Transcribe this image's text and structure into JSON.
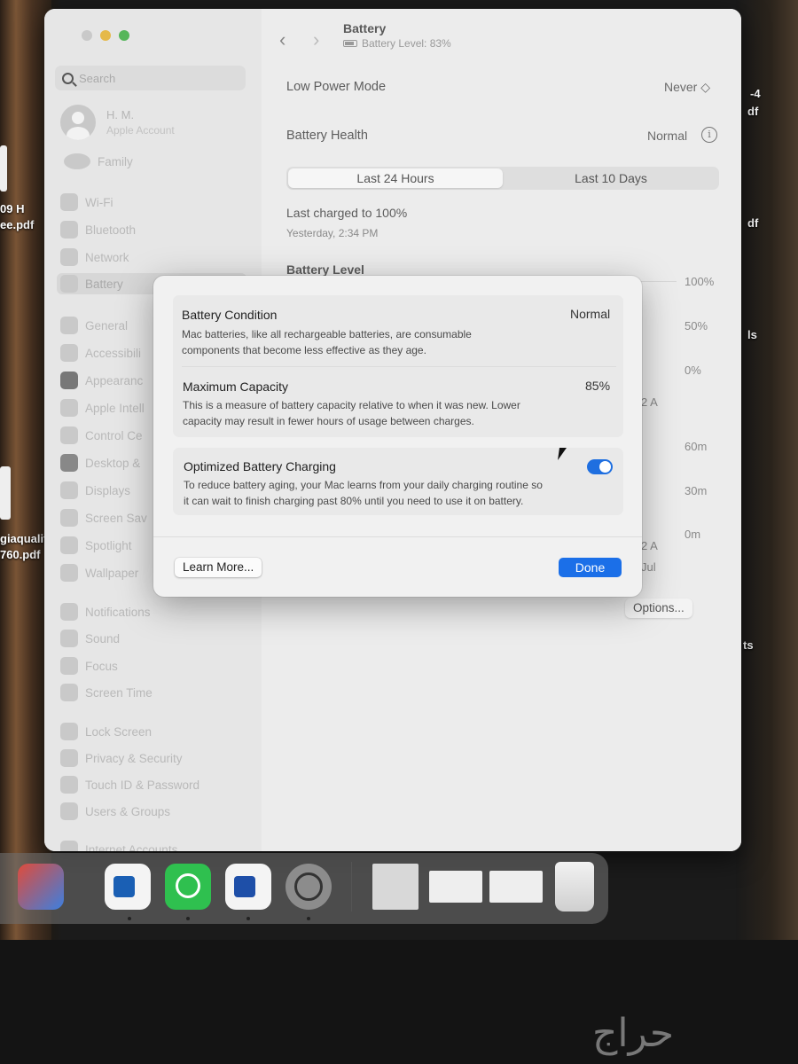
{
  "desktop": {
    "labels": [
      "-4",
      "df",
      "09 H",
      "ee.pdf",
      "df",
      "ls",
      "giaqualit",
      "760.pdf",
      "ts"
    ]
  },
  "window": {
    "title": "Battery",
    "subtitle": "Battery Level: 83%",
    "nav_back_glyph": "‹",
    "nav_forward_glyph": "›"
  },
  "sidebar": {
    "search_placeholder": "Search",
    "account_name": "H. M.",
    "account_sub": "Apple Account",
    "family": "Family",
    "items": [
      {
        "label": "Wi-Fi",
        "icon": "wifi-icon"
      },
      {
        "label": "Bluetooth",
        "icon": "bluetooth-icon"
      },
      {
        "label": "Network",
        "icon": "globe-icon"
      },
      {
        "label": "Battery",
        "icon": "battery-icon"
      },
      {
        "label": "General",
        "icon": "gear-icon"
      },
      {
        "label": "Accessibili",
        "icon": "accessibility-icon"
      },
      {
        "label": "Appearanc",
        "icon": "appearance-icon"
      },
      {
        "label": "Apple Intell",
        "icon": "apple-intelligence-icon"
      },
      {
        "label": "Control Ce",
        "icon": "control-center-icon"
      },
      {
        "label": "Desktop &",
        "icon": "desktop-dock-icon"
      },
      {
        "label": "Displays",
        "icon": "displays-icon"
      },
      {
        "label": "Screen Sav",
        "icon": "screensaver-icon"
      },
      {
        "label": "Spotlight",
        "icon": "spotlight-icon"
      },
      {
        "label": "Wallpaper",
        "icon": "wallpaper-icon"
      },
      {
        "label": "Notifications",
        "icon": "notifications-icon"
      },
      {
        "label": "Sound",
        "icon": "sound-icon"
      },
      {
        "label": "Focus",
        "icon": "focus-icon"
      },
      {
        "label": "Screen Time",
        "icon": "screen-time-icon"
      },
      {
        "label": "Lock Screen",
        "icon": "lock-icon"
      },
      {
        "label": "Privacy & Security",
        "icon": "privacy-hand-icon"
      },
      {
        "label": "Touch ID & Password",
        "icon": "fingerprint-icon"
      },
      {
        "label": "Users & Groups",
        "icon": "users-icon"
      },
      {
        "label": "Internet Accounts",
        "icon": "at-icon"
      }
    ]
  },
  "main": {
    "low_power_label": "Low Power Mode",
    "low_power_value": "Never ◇",
    "health_label": "Battery Health",
    "health_value": "Normal",
    "info_glyph": "i",
    "tabs": [
      "Last 24 Hours",
      "Last 10 Days"
    ],
    "last_charged": "Last charged to 100%",
    "last_charged_time": "Yesterday, 2:34 PM",
    "battery_level_heading": "Battery Level",
    "level_axis": [
      "100%",
      "50%",
      "0%"
    ],
    "time_axis": [
      "60m",
      "30m",
      "0m"
    ],
    "partial_labels": [
      "2 A",
      "2 A",
      "Jul"
    ],
    "options_label": "Options...",
    "help_label": "?"
  },
  "modal": {
    "condition_title": "Battery Condition",
    "condition_value": "Normal",
    "condition_desc_1": "Mac batteries, like all rechargeable batteries, are consumable",
    "condition_desc_2": "components that become less effective as they age.",
    "capacity_title": "Maximum Capacity",
    "capacity_value": "85%",
    "capacity_desc_1": "This is a measure of battery capacity relative to when it was new. Lower",
    "capacity_desc_2": "capacity may result in fewer hours of usage between charges.",
    "optimized_title": "Optimized Battery Charging",
    "optimized_desc_1": "To reduce battery aging, your Mac learns from your daily charging routine so",
    "optimized_desc_2": "it can wait to finish charging past 80% until you need to use it on battery.",
    "optimized_on": true,
    "learn_more": "Learn More...",
    "done": "Done",
    "accent": "#1b6fe8"
  },
  "dock": {
    "apps": [
      {
        "name": "iphone-mirroring-icon",
        "color": "#d9d9d9"
      },
      {
        "name": "outlook-icon",
        "color": "#f4f4f4"
      },
      {
        "name": "whatsapp-icon",
        "color": "#2fc04f"
      },
      {
        "name": "word-icon",
        "color": "#f4f4f4"
      },
      {
        "name": "system-settings-icon",
        "color": "#8c8c8c"
      }
    ]
  },
  "watermark": "حراج"
}
